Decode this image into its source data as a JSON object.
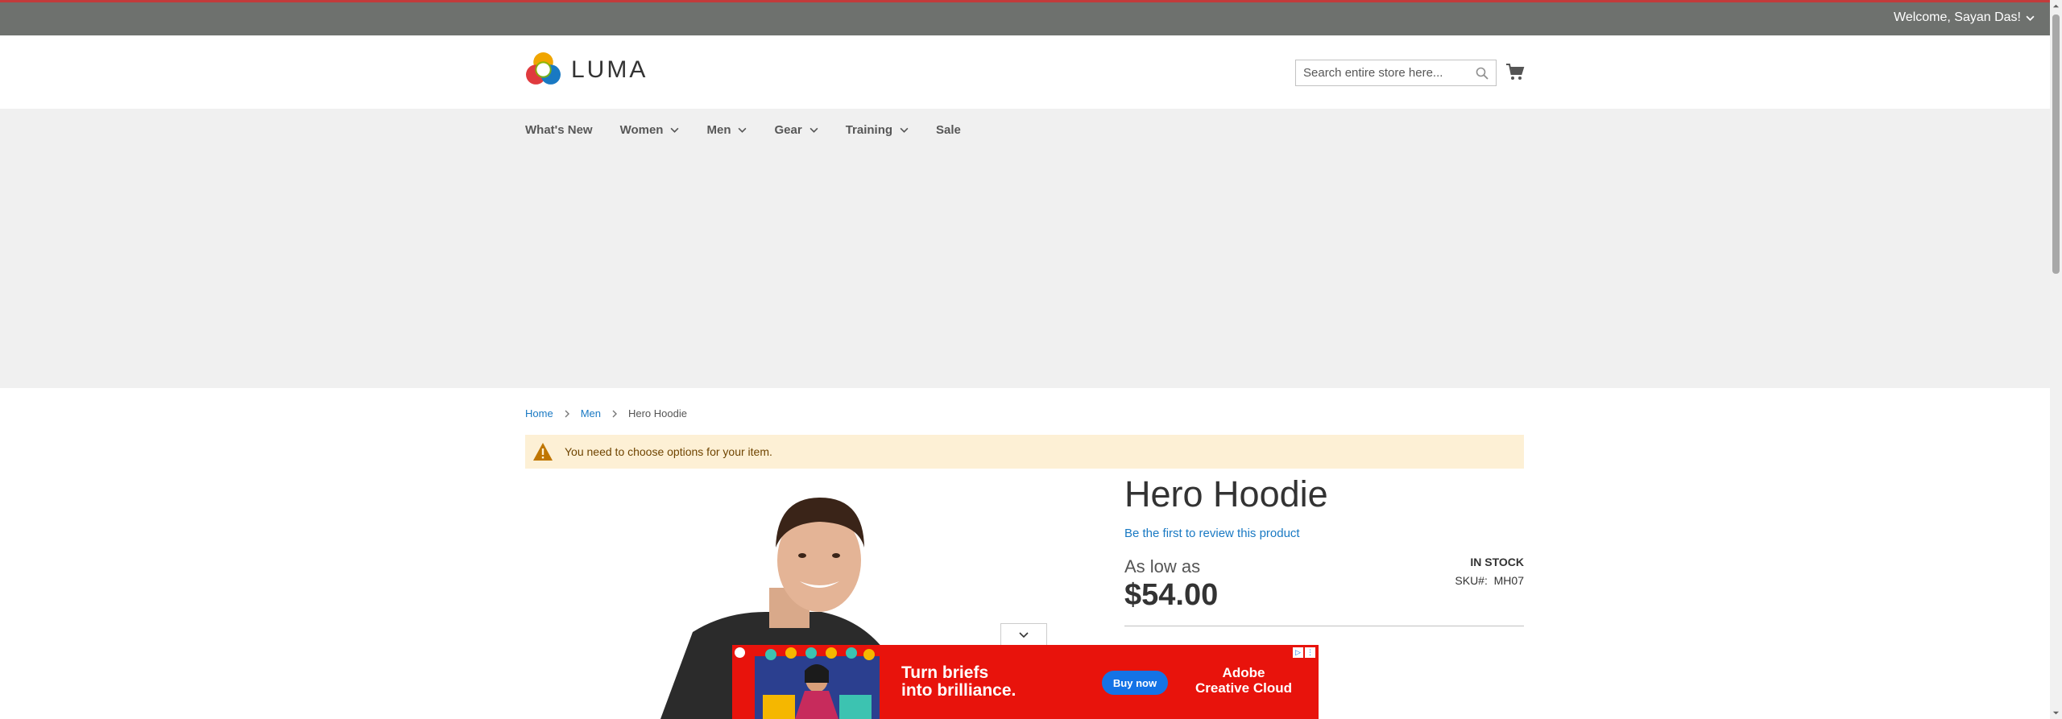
{
  "topbar": {
    "welcome": "Welcome, Sayan Das!"
  },
  "header": {
    "logo_text": "LUMA",
    "search_placeholder": "Search entire store here..."
  },
  "nav": {
    "items": [
      {
        "label": "What's New",
        "has_dropdown": false
      },
      {
        "label": "Women",
        "has_dropdown": true
      },
      {
        "label": "Men",
        "has_dropdown": true
      },
      {
        "label": "Gear",
        "has_dropdown": true
      },
      {
        "label": "Training",
        "has_dropdown": true
      },
      {
        "label": "Sale",
        "has_dropdown": false
      }
    ]
  },
  "breadcrumbs": {
    "home": "Home",
    "men": "Men",
    "current": "Hero Hoodie"
  },
  "alert": {
    "message": "You need to choose options for your item."
  },
  "product": {
    "title": "Hero Hoodie",
    "review_link": "Be the first to review this product",
    "stock": "In stock",
    "sku_label": "SKU#:",
    "sku_value": "MH07",
    "as_low_as": "As low as",
    "price": "$54.00"
  },
  "ad": {
    "headline_line1": "Turn briefs",
    "headline_line2": "into brilliance.",
    "button": "Buy now",
    "brand_line1": "Adobe",
    "brand_line2": "Creative Cloud"
  },
  "colors": {
    "topbar": "#6e716e",
    "nav_bg": "#f0f0f0",
    "link": "#1979c3",
    "alert_bg": "#fdf0d5",
    "ad_bg": "#e8130c",
    "ad_button": "#1473e6"
  }
}
